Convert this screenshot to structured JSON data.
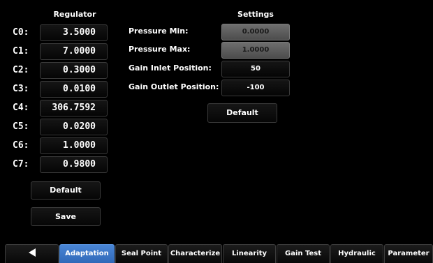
{
  "regulator": {
    "title": "Regulator",
    "rows": [
      {
        "label": "C0:",
        "value": "3.5000"
      },
      {
        "label": "C1:",
        "value": "7.0000"
      },
      {
        "label": "C2:",
        "value": "0.3000"
      },
      {
        "label": "C3:",
        "value": "0.0100"
      },
      {
        "label": "C4:",
        "value": "306.7592"
      },
      {
        "label": "C5:",
        "value": "0.0200"
      },
      {
        "label": "C6:",
        "value": "1.0000"
      },
      {
        "label": "C7:",
        "value": "0.9800"
      }
    ],
    "default_label": "Default",
    "save_label": "Save"
  },
  "settings": {
    "title": "Settings",
    "rows": [
      {
        "label": "Pressure Min:",
        "value": "0.0000",
        "disabled": true
      },
      {
        "label": "Pressure Max:",
        "value": "1.0000",
        "disabled": true
      },
      {
        "label": "Gain Inlet Position:",
        "value": "50",
        "disabled": false
      },
      {
        "label": "Gain Outlet Position:",
        "value": "-100",
        "disabled": false
      }
    ],
    "default_label": "Default"
  },
  "tabs": {
    "back_icon": "back-arrow-icon",
    "items": [
      {
        "label": "Adaptation",
        "active": true
      },
      {
        "label": "Seal Point",
        "active": false
      },
      {
        "label": "Characterize",
        "active": false
      },
      {
        "label": "Linearity",
        "active": false
      },
      {
        "label": "Gain Test",
        "active": false
      },
      {
        "label": "Hydraulic",
        "active": false
      },
      {
        "label": "Parameter",
        "active": false
      }
    ]
  },
  "colors": {
    "background": "#000000",
    "active_tab": "#3b78c8",
    "disabled_field": "#5e5e5e"
  }
}
